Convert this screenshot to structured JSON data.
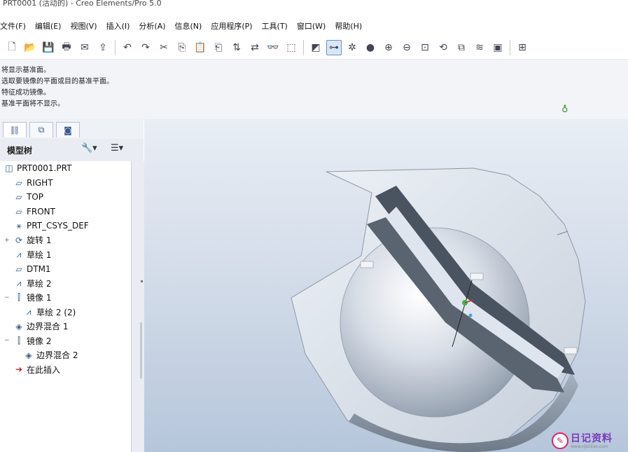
{
  "window": {
    "title": "PRT0001 (活动的) - Creo Elements/Pro 5.0"
  },
  "menu": [
    {
      "label": "文件(F)"
    },
    {
      "label": "编辑(E)"
    },
    {
      "label": "视图(V)"
    },
    {
      "label": "插入(I)"
    },
    {
      "label": "分析(A)"
    },
    {
      "label": "信息(N)"
    },
    {
      "label": "应用程序(P)"
    },
    {
      "label": "工具(T)"
    },
    {
      "label": "窗口(W)"
    },
    {
      "label": "帮助(H)"
    }
  ],
  "toolbar": {
    "groups": [
      [
        {
          "name": "new-icon",
          "glyph": "🗋"
        },
        {
          "name": "open-icon",
          "glyph": "📂"
        },
        {
          "name": "save-icon",
          "glyph": "💾"
        },
        {
          "name": "print-icon",
          "glyph": "🖶"
        },
        {
          "name": "email-icon",
          "glyph": "✉"
        },
        {
          "name": "send-icon",
          "glyph": "⇪"
        }
      ],
      [
        {
          "name": "undo-icon",
          "glyph": "↶"
        },
        {
          "name": "redo-icon",
          "glyph": "↷"
        },
        {
          "name": "cut-icon",
          "glyph": "✂"
        },
        {
          "name": "copy-icon",
          "glyph": "⎘"
        },
        {
          "name": "paste-icon",
          "glyph": "📋"
        },
        {
          "name": "paste-special-icon",
          "glyph": "⎗"
        },
        {
          "name": "regenerate-icon",
          "glyph": "⇅"
        },
        {
          "name": "regen-manager-icon",
          "glyph": "⇄"
        },
        {
          "name": "find-icon",
          "glyph": "👓"
        },
        {
          "name": "select-box-icon",
          "glyph": "⬚"
        }
      ],
      [
        {
          "name": "repaint-icon",
          "glyph": "◩"
        },
        {
          "name": "spin-center-icon",
          "glyph": "⊶",
          "selected": true
        },
        {
          "name": "orient-mode-icon",
          "glyph": "✲"
        },
        {
          "name": "appearance-icon",
          "glyph": "●"
        },
        {
          "name": "zoom-in-icon",
          "glyph": "⊕"
        },
        {
          "name": "zoom-out-icon",
          "glyph": "⊖"
        },
        {
          "name": "refit-icon",
          "glyph": "⊡"
        },
        {
          "name": "reorient-icon",
          "glyph": "⟲"
        },
        {
          "name": "saved-views-icon",
          "glyph": "⧉"
        },
        {
          "name": "layers-icon",
          "glyph": "≋"
        },
        {
          "name": "view-manager-icon",
          "glyph": "▣"
        }
      ],
      [
        {
          "name": "display-style-icon",
          "glyph": "⊞"
        }
      ]
    ]
  },
  "messages": [
    "将显示基准面。",
    "选取要镜像的平面或目的基准平面。",
    "特征成功镜像。",
    "基准平面将不显示。"
  ],
  "navigator": {
    "tabs": [
      {
        "name": "model-tree-tab-icon",
        "glyph": "⛓"
      },
      {
        "name": "folder-browser-tab-icon",
        "glyph": "⧉"
      },
      {
        "name": "favorites-tab-icon",
        "glyph": "◙"
      }
    ],
    "title": "模型树",
    "settings_glyph": "🔧▾",
    "show_glyph": "☰▾"
  },
  "tree": [
    {
      "label": "PRT0001.PRT",
      "icon": "◫",
      "indent": 0,
      "expander": ""
    },
    {
      "label": "RIGHT",
      "icon": "▱",
      "indent": 1,
      "expander": ""
    },
    {
      "label": "TOP",
      "icon": "▱",
      "indent": 1,
      "expander": ""
    },
    {
      "label": "FRONT",
      "icon": "▱",
      "indent": 1,
      "expander": ""
    },
    {
      "label": "PRT_CSYS_DEF",
      "icon": "⚹",
      "indent": 1,
      "expander": ""
    },
    {
      "label": "旋转 1",
      "icon": "⟳",
      "indent": 1,
      "expander": "+"
    },
    {
      "label": "草绘 1",
      "icon": "⩘",
      "indent": 1,
      "expander": ""
    },
    {
      "label": "DTM1",
      "icon": "▱",
      "indent": 1,
      "expander": ""
    },
    {
      "label": "草绘 2",
      "icon": "⩘",
      "indent": 1,
      "expander": ""
    },
    {
      "label": "镜像 1",
      "icon": "⫿",
      "indent": 1,
      "expander": "−"
    },
    {
      "label": "草绘 2 (2)",
      "icon": "⩘",
      "indent": 2,
      "expander": ""
    },
    {
      "label": "边界混合 1",
      "icon": "◈",
      "indent": 1,
      "expander": ""
    },
    {
      "label": "镜像 2",
      "icon": "⫿",
      "indent": 1,
      "expander": "−"
    },
    {
      "label": "边界混合 2",
      "icon": "◈",
      "indent": 2,
      "expander": ""
    },
    {
      "label": "在此插入",
      "icon": "➔",
      "indent": 1,
      "expander": "",
      "red": true
    }
  ],
  "watermark": {
    "text": "日记资料",
    "url": "www.rijiziliao.com"
  }
}
